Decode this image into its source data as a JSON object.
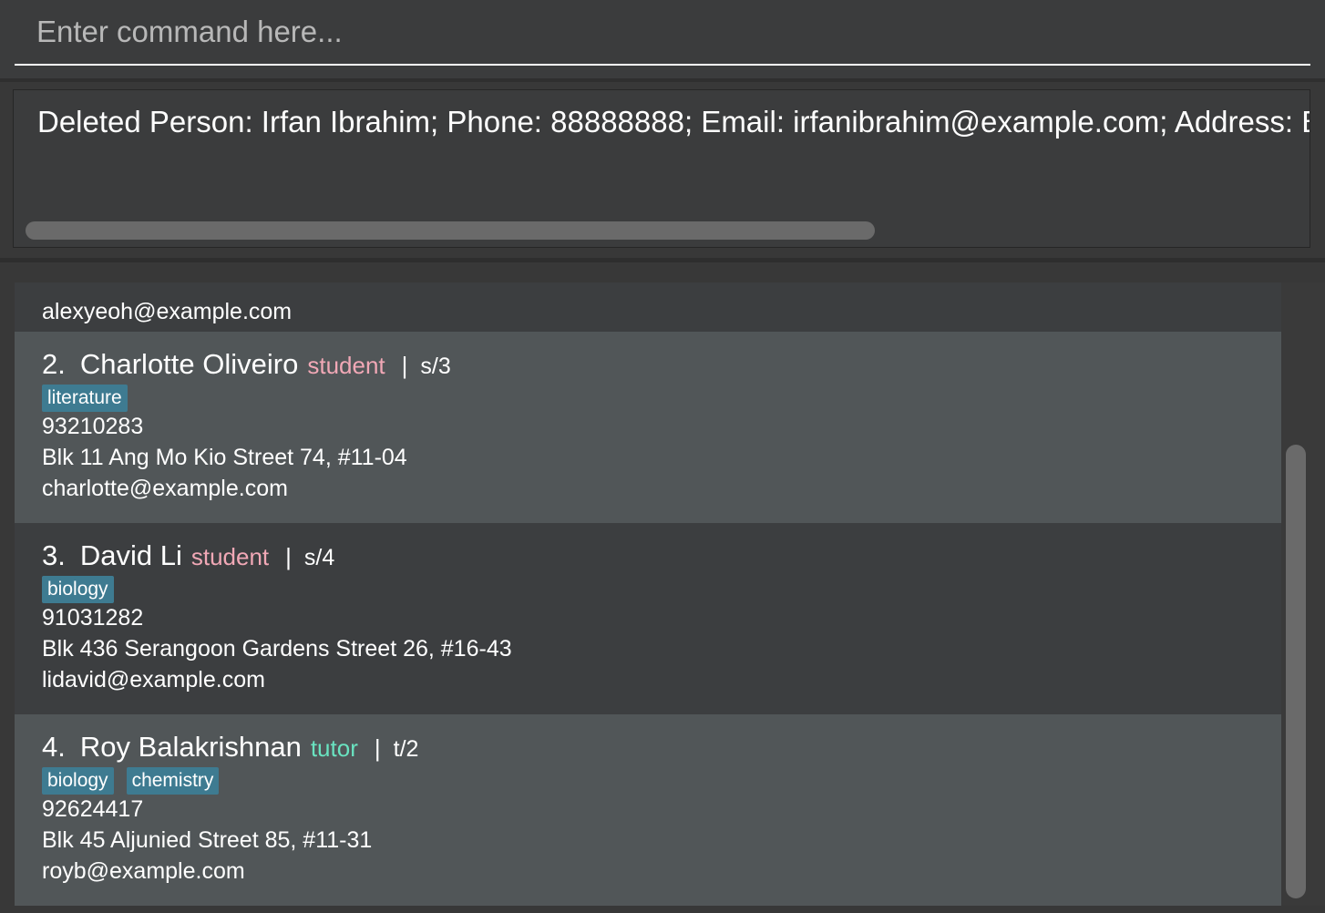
{
  "command": {
    "placeholder": "Enter command here...",
    "value": ""
  },
  "result": {
    "message": "Deleted Person: Irfan Ibrahim; Phone: 88888888; Email: irfanibrahim@example.com; Address: Bll"
  },
  "people": [
    {
      "email": "alexyeoh@example.com"
    },
    {
      "index": "2.",
      "name": "Charlotte Oliveiro",
      "role": "student",
      "separator": "|",
      "code": "s/3",
      "tags": [
        "literature"
      ],
      "phone": "93210283",
      "address": "Blk 11 Ang Mo Kio Street 74, #11-04",
      "email": "charlotte@example.com"
    },
    {
      "index": "3.",
      "name": "David Li",
      "role": "student",
      "separator": "|",
      "code": "s/4",
      "tags": [
        "biology"
      ],
      "phone": "91031282",
      "address": "Blk 436 Serangoon Gardens Street 26, #16-43",
      "email": "lidavid@example.com"
    },
    {
      "index": "4.",
      "name": "Roy Balakrishnan",
      "role": "tutor",
      "separator": "|",
      "code": "t/2",
      "tags": [
        "biology",
        "chemistry"
      ],
      "phone": "92624417",
      "address": "Blk 45 Aljunied Street 85, #11-31",
      "email": "royb@example.com"
    }
  ],
  "colors": {
    "student_role": "#f1a8b6",
    "tutor_role": "#69e3c0",
    "tag_background": "#3e7b91"
  }
}
